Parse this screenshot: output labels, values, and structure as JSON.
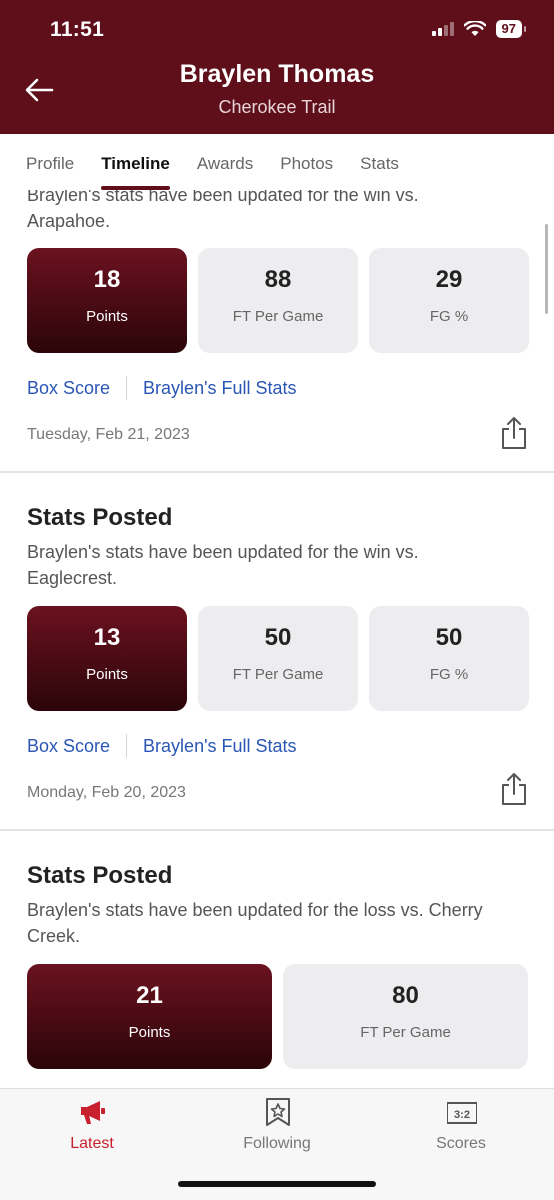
{
  "status_bar": {
    "time": "11:51",
    "battery": "97"
  },
  "header": {
    "title": "Braylen Thomas",
    "subtitle": "Cherokee Trail"
  },
  "tabs": [
    {
      "label": "Profile",
      "active": false
    },
    {
      "label": "Timeline",
      "active": true
    },
    {
      "label": "Awards",
      "active": false
    },
    {
      "label": "Photos",
      "active": false
    },
    {
      "label": "Stats",
      "active": false
    }
  ],
  "feed": [
    {
      "desc": "Braylen's stats have been updated for the win vs. Arapahoe.",
      "stats": [
        {
          "value": "18",
          "label": "Points"
        },
        {
          "value": "88",
          "label": "FT Per Game"
        },
        {
          "value": "29",
          "label": "FG %"
        }
      ],
      "links": {
        "box_score": "Box Score",
        "full_stats": "Braylen's Full Stats"
      },
      "date": "Tuesday, Feb 21, 2023"
    },
    {
      "title": "Stats Posted",
      "desc": "Braylen's stats have been updated for the win vs. Eaglecrest.",
      "stats": [
        {
          "value": "13",
          "label": "Points"
        },
        {
          "value": "50",
          "label": "FT Per Game"
        },
        {
          "value": "50",
          "label": "FG %"
        }
      ],
      "links": {
        "box_score": "Box Score",
        "full_stats": "Braylen's Full Stats"
      },
      "date": "Monday, Feb 20, 2023"
    },
    {
      "title": "Stats Posted",
      "desc": "Braylen's stats have been updated for the loss vs. Cherry Creek.",
      "stats": [
        {
          "value": "21",
          "label": "Points"
        },
        {
          "value": "80",
          "label": "FT Per Game"
        }
      ]
    }
  ],
  "bottom_nav": [
    {
      "label": "Latest",
      "icon": "megaphone-icon",
      "active": true
    },
    {
      "label": "Following",
      "icon": "bookmark-star-icon",
      "active": false
    },
    {
      "label": "Scores",
      "icon": "scoreboard-icon",
      "active": false
    }
  ],
  "colors": {
    "brand": "#5e0f1a",
    "accent_link": "#2a56b5",
    "active_nav": "#c8202c"
  }
}
